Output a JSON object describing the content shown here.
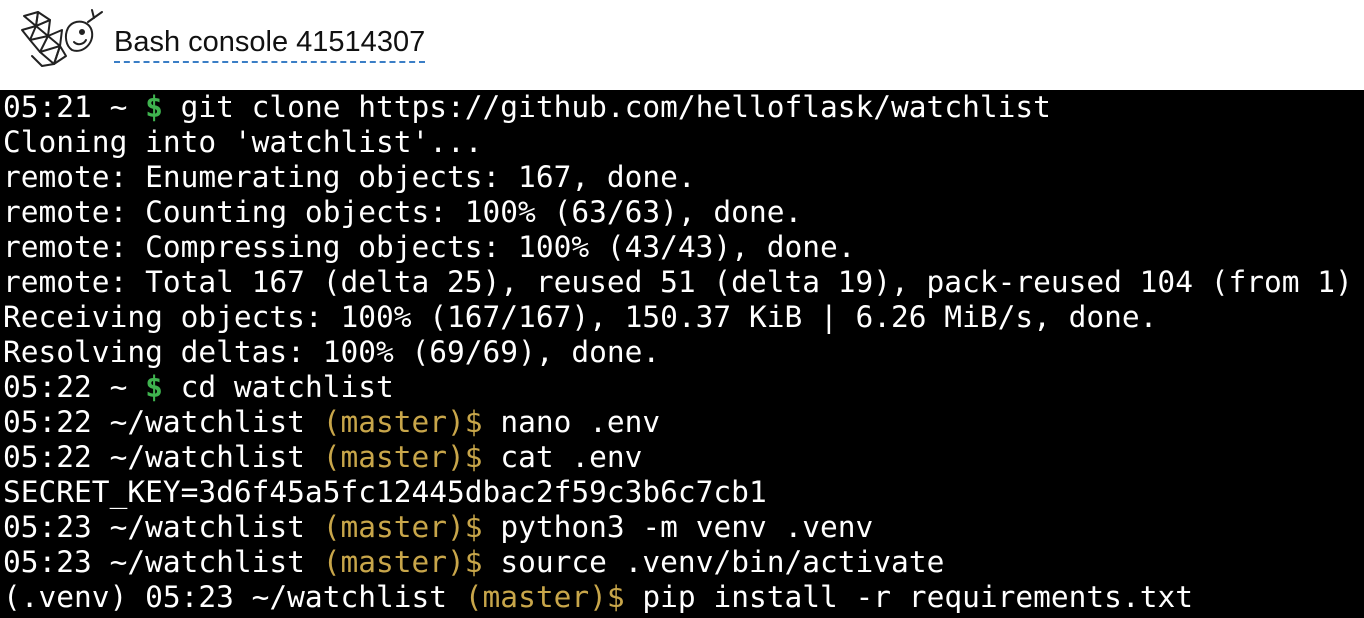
{
  "header": {
    "title": "Bash console 41514307",
    "logo_icon": "pythonanywhere-logo-icon"
  },
  "terminal": {
    "lines": [
      {
        "prompt": "05:21 ~ ",
        "branch": "",
        "dollar": "$",
        "cmd": " git clone https://github.com/helloflask/watchlist"
      },
      {
        "text": "Cloning into 'watchlist'..."
      },
      {
        "text": "remote: Enumerating objects: 167, done."
      },
      {
        "text": "remote: Counting objects: 100% (63/63), done."
      },
      {
        "text": "remote: Compressing objects: 100% (43/43), done."
      },
      {
        "text": "remote: Total 167 (delta 25), reused 51 (delta 19), pack-reused 104 (from 1)"
      },
      {
        "text": "Receiving objects: 100% (167/167), 150.37 KiB | 6.26 MiB/s, done."
      },
      {
        "text": "Resolving deltas: 100% (69/69), done."
      },
      {
        "prompt": "05:22 ~ ",
        "branch": "",
        "dollar": "$",
        "cmd": " cd watchlist"
      },
      {
        "prompt": "05:22 ~/watchlist ",
        "branch": "(master)",
        "dollar": "$",
        "cmd": " nano .env"
      },
      {
        "prompt": "05:22 ~/watchlist ",
        "branch": "(master)",
        "dollar": "$",
        "cmd": " cat .env"
      },
      {
        "text": "SECRET_KEY=3d6f45a5fc12445dbac2f59c3b6c7cb1"
      },
      {
        "prompt": "05:23 ~/watchlist ",
        "branch": "(master)",
        "dollar": "$",
        "cmd": " python3 -m venv .venv"
      },
      {
        "prompt": "05:23 ~/watchlist ",
        "branch": "(master)",
        "dollar": "$",
        "cmd": " source .venv/bin/activate"
      },
      {
        "prompt": "(.venv) 05:23 ~/watchlist ",
        "branch": "(master)",
        "dollar": "$",
        "cmd": " pip install -r requirements.txt"
      }
    ]
  },
  "colors": {
    "terminal_bg": "#000000",
    "text": "#ffffff",
    "prompt_dollar_home": "#3fb34f",
    "branch": "#c8a64a",
    "title_underline": "#3a7ec6"
  }
}
